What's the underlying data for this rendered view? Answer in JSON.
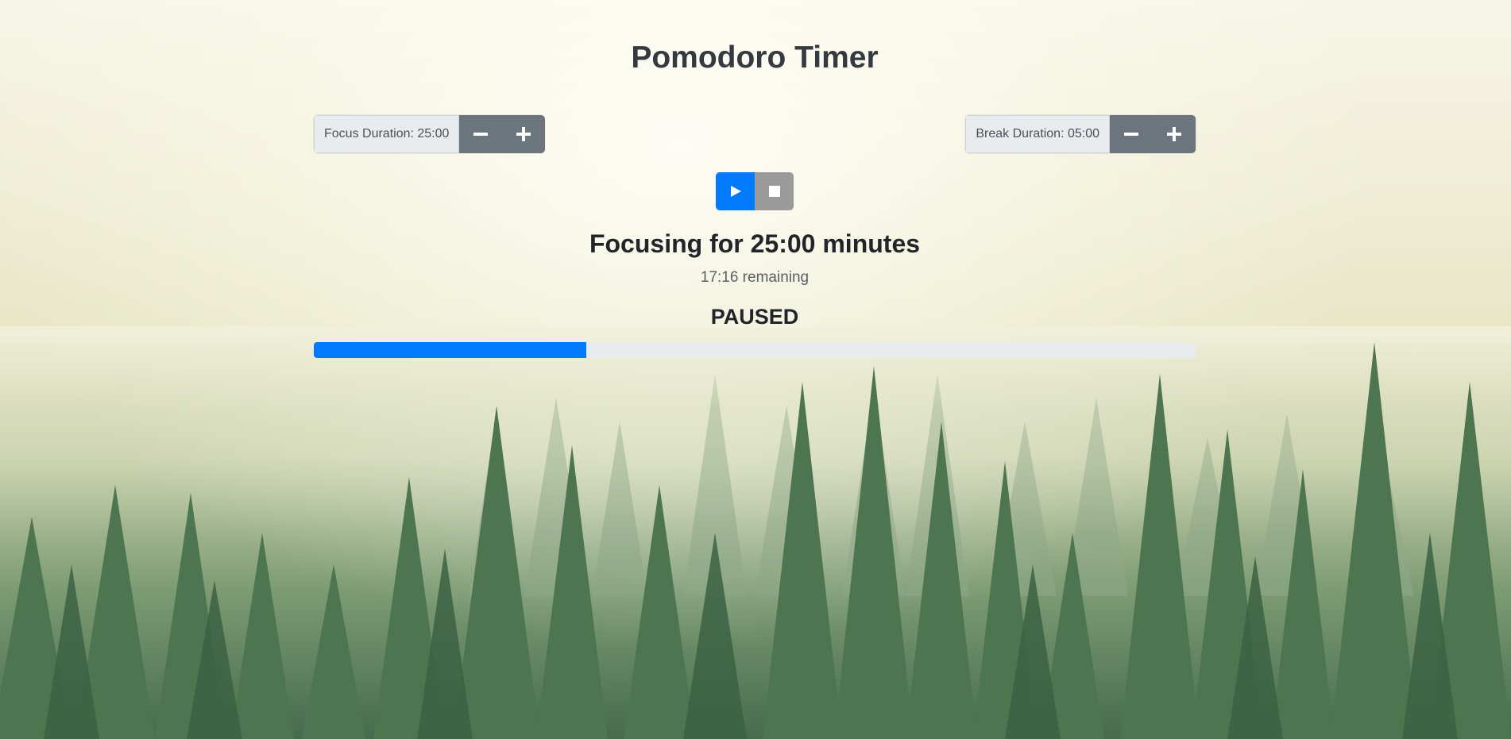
{
  "app": {
    "title": "Pomodoro Timer"
  },
  "focus": {
    "label": "Focus Duration: 25:00",
    "decrease_icon": "minus-icon",
    "increase_icon": "plus-icon"
  },
  "break": {
    "label": "Break Duration: 05:00",
    "decrease_icon": "minus-icon",
    "increase_icon": "plus-icon"
  },
  "controls": {
    "play_icon": "play-icon",
    "stop_icon": "stop-icon"
  },
  "status": {
    "heading": "Focusing for 25:00 minutes",
    "remaining": "17:16 remaining",
    "state": "PAUSED"
  },
  "progress": {
    "fraction": 0.3093
  },
  "colors": {
    "primary": "#007bff",
    "secondary": "#6c757d",
    "stop": "#9a9a9a",
    "track": "#e9ecef"
  }
}
